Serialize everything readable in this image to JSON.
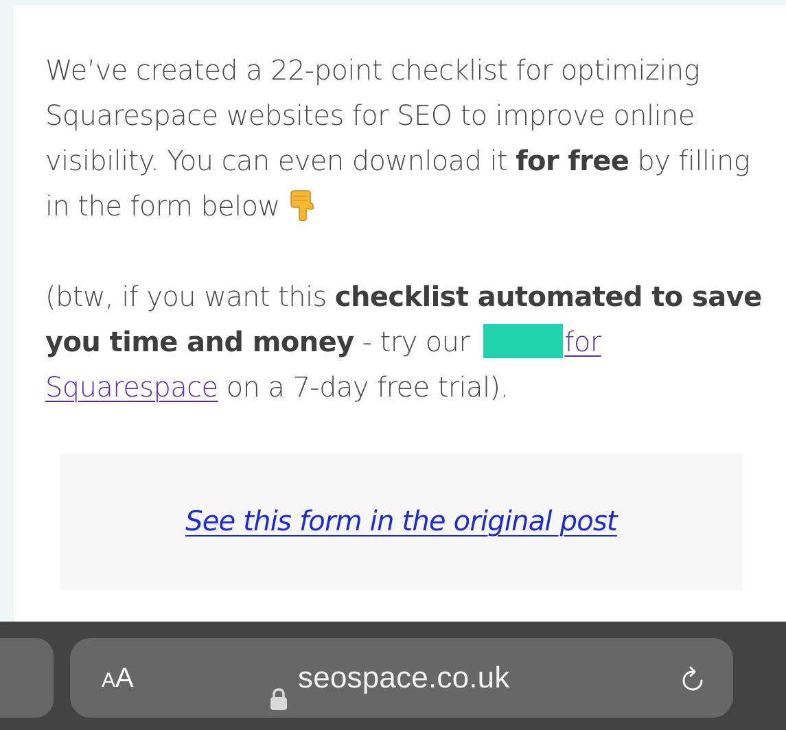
{
  "article": {
    "paragraph_1": {
      "text_before_bold": "We’ve created a 22-point checklist for optimizing Squarespace websites for SEO to improve online visibility. You can even download it ",
      "bold_text": "for free",
      "text_after_bold": " by filling in the form below",
      "emoji_icon": "backhand-index-pointing-down-icon"
    },
    "paragraph_2": {
      "text_before_bold": "(btw, if you want this ",
      "bold_text": "checklist automated to save you time and money",
      "text_middle": " - try our ",
      "redaction_color": "#22d3b0",
      "link_text_part1": "for",
      "link_text_part2": "Squarespace",
      "text_after_link": " on a 7-day free trial)."
    }
  },
  "form_placeholder": {
    "link_text": "See this form in the original post"
  },
  "browser_toolbar": {
    "text_size_label_large": "A",
    "text_size_label_small": "A",
    "url": "seospace.co.uk",
    "lock_icon": "lock-icon",
    "reload_icon": "reload-icon"
  },
  "colors": {
    "link": "#5a2ea6",
    "form_link": "#1a2bd6",
    "toolbar_bg": "#434343",
    "address_bar_bg": "#676767"
  }
}
